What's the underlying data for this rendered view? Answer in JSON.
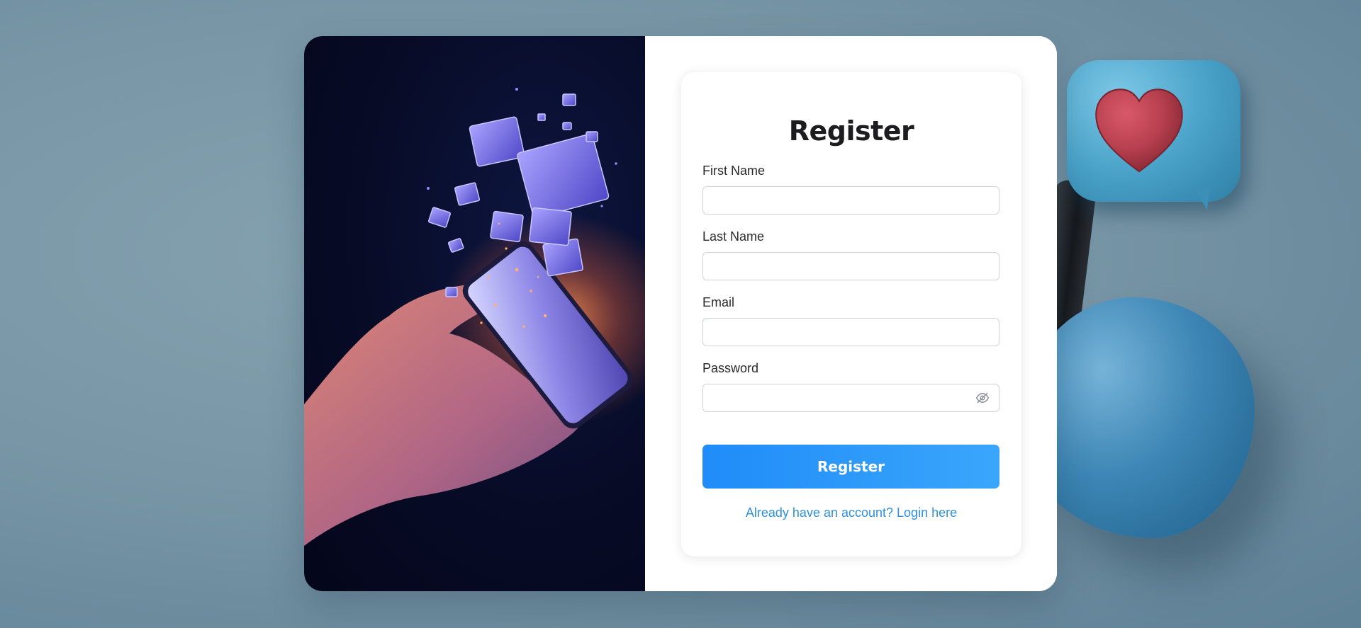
{
  "page": {
    "background_color": "#7896a6"
  },
  "hero": {
    "image_description_icon": "hand-phone-gifts-illustration"
  },
  "form": {
    "title": "Register",
    "fields": [
      {
        "label": "First Name",
        "value": "",
        "placeholder": "",
        "type": "text"
      },
      {
        "label": "Last Name",
        "value": "",
        "placeholder": "",
        "type": "text"
      },
      {
        "label": "Email",
        "value": "",
        "placeholder": "",
        "type": "email"
      },
      {
        "label": "Password",
        "value": "",
        "placeholder": "",
        "type": "password"
      }
    ],
    "password_toggle_icon": "eye-off-icon",
    "submit_label": "Register",
    "login_link": "Already have an account? Login here"
  },
  "colors": {
    "accent": "#1f8cf9",
    "accent_light": "#3aa6fb",
    "link": "#2f8fde",
    "hero_bg": "#070b26"
  }
}
